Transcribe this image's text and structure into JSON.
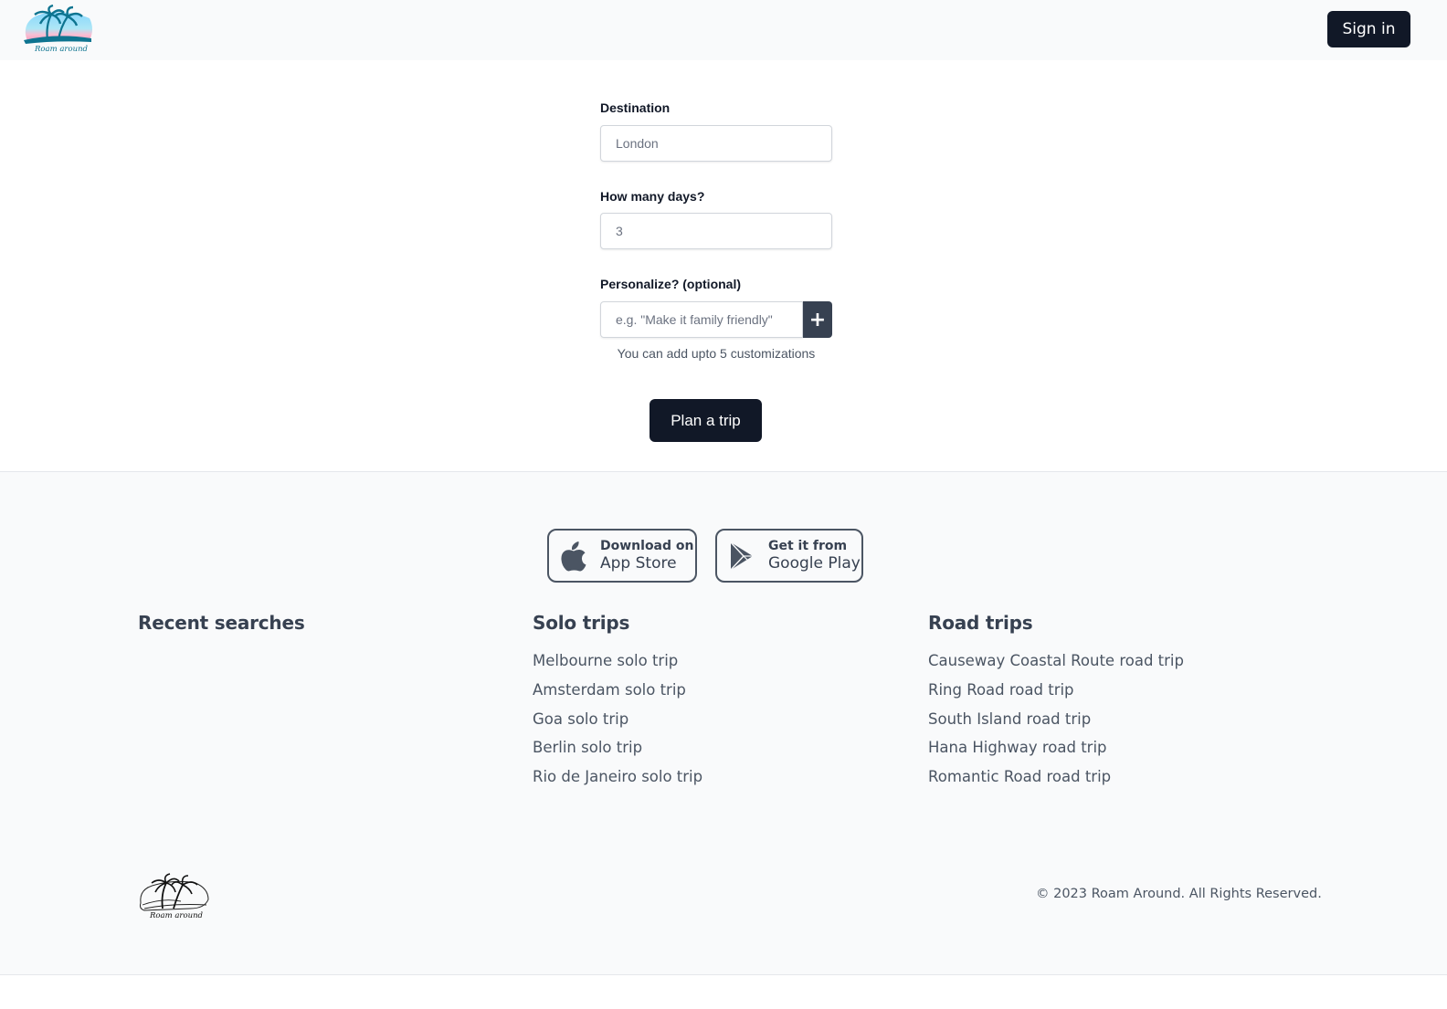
{
  "header": {
    "logo_alt": "Roam around",
    "logo_text": "Roam around",
    "sign_in_label": "Sign in"
  },
  "form": {
    "destination": {
      "label": "Destination",
      "placeholder": "London",
      "value": ""
    },
    "days": {
      "label": "How many days?",
      "placeholder": "3",
      "value": ""
    },
    "personalize": {
      "label": "Personalize? (optional)",
      "placeholder": "e.g. \"Make it family friendly\"",
      "value": "",
      "add_icon": "plus-icon",
      "add_label": "+"
    },
    "hint": "You can add upto 5 customizations",
    "submit_label": "Plan a trip"
  },
  "footer": {
    "app_store": {
      "icon": "apple-icon",
      "small": "Download on",
      "big": "App Store"
    },
    "google_play": {
      "icon": "play-store-icon",
      "small": "Get it from",
      "big": "Google Play"
    },
    "columns": {
      "recent": {
        "title": "Recent searches",
        "items": []
      },
      "solo": {
        "title": "Solo trips",
        "items": [
          "Melbourne solo trip",
          "Amsterdam solo trip",
          "Goa solo trip",
          "Berlin solo trip",
          "Rio de Janeiro solo trip"
        ]
      },
      "road": {
        "title": "Road trips",
        "items": [
          "Causeway Coastal Route road trip",
          "Ring Road road trip",
          "South Island road trip",
          "Hana Highway road trip",
          "Romantic Road road trip"
        ]
      }
    },
    "logo_text": "Roam around",
    "copyright": "© 2023 Roam Around. All Rights Reserved."
  },
  "colors": {
    "primary_dark": "#111827",
    "plus_button": "#374151",
    "footer_bg": "#f9fafb",
    "logo_teal": "#0e7490",
    "logo_pink": "#f9a8c4",
    "logo_sky": "#7dd3fc"
  }
}
